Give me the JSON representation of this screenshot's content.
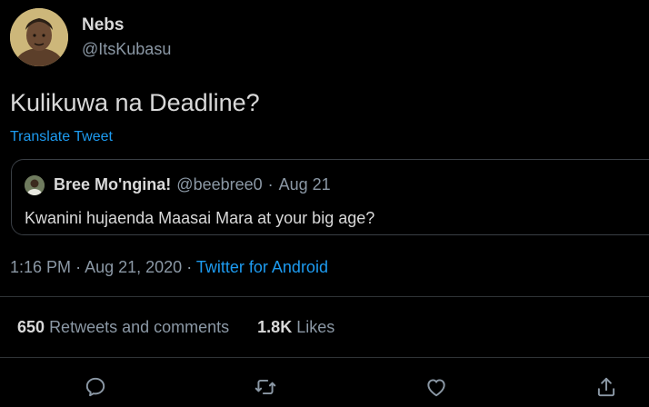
{
  "author": {
    "display_name": "Nebs",
    "handle": "@ItsKubasu"
  },
  "tweet": {
    "text": "Kulikuwa na Deadline?",
    "translate_label": "Translate Tweet",
    "time": "1:16 PM",
    "date": "Aug 21, 2020",
    "separator": "·",
    "source": "Twitter for Android"
  },
  "quoted": {
    "display_name": "Bree Mo'ngina!",
    "handle": "@beebree0",
    "date": "Aug 21",
    "separator": "·",
    "text": "Kwanini hujaenda Maasai Mara at your big age?"
  },
  "stats": {
    "retweets_count": "650",
    "retweets_label": "Retweets and comments",
    "likes_count": "1.8K",
    "likes_label": "Likes"
  },
  "actions": {
    "icons": [
      "reply-icon",
      "retweet-icon",
      "like-icon",
      "share-icon"
    ]
  },
  "colors": {
    "background": "#000000",
    "text": "#d9d9d9",
    "secondary": "#8b98a5",
    "accent": "#1d9bf0",
    "divider": "#2f3336"
  }
}
